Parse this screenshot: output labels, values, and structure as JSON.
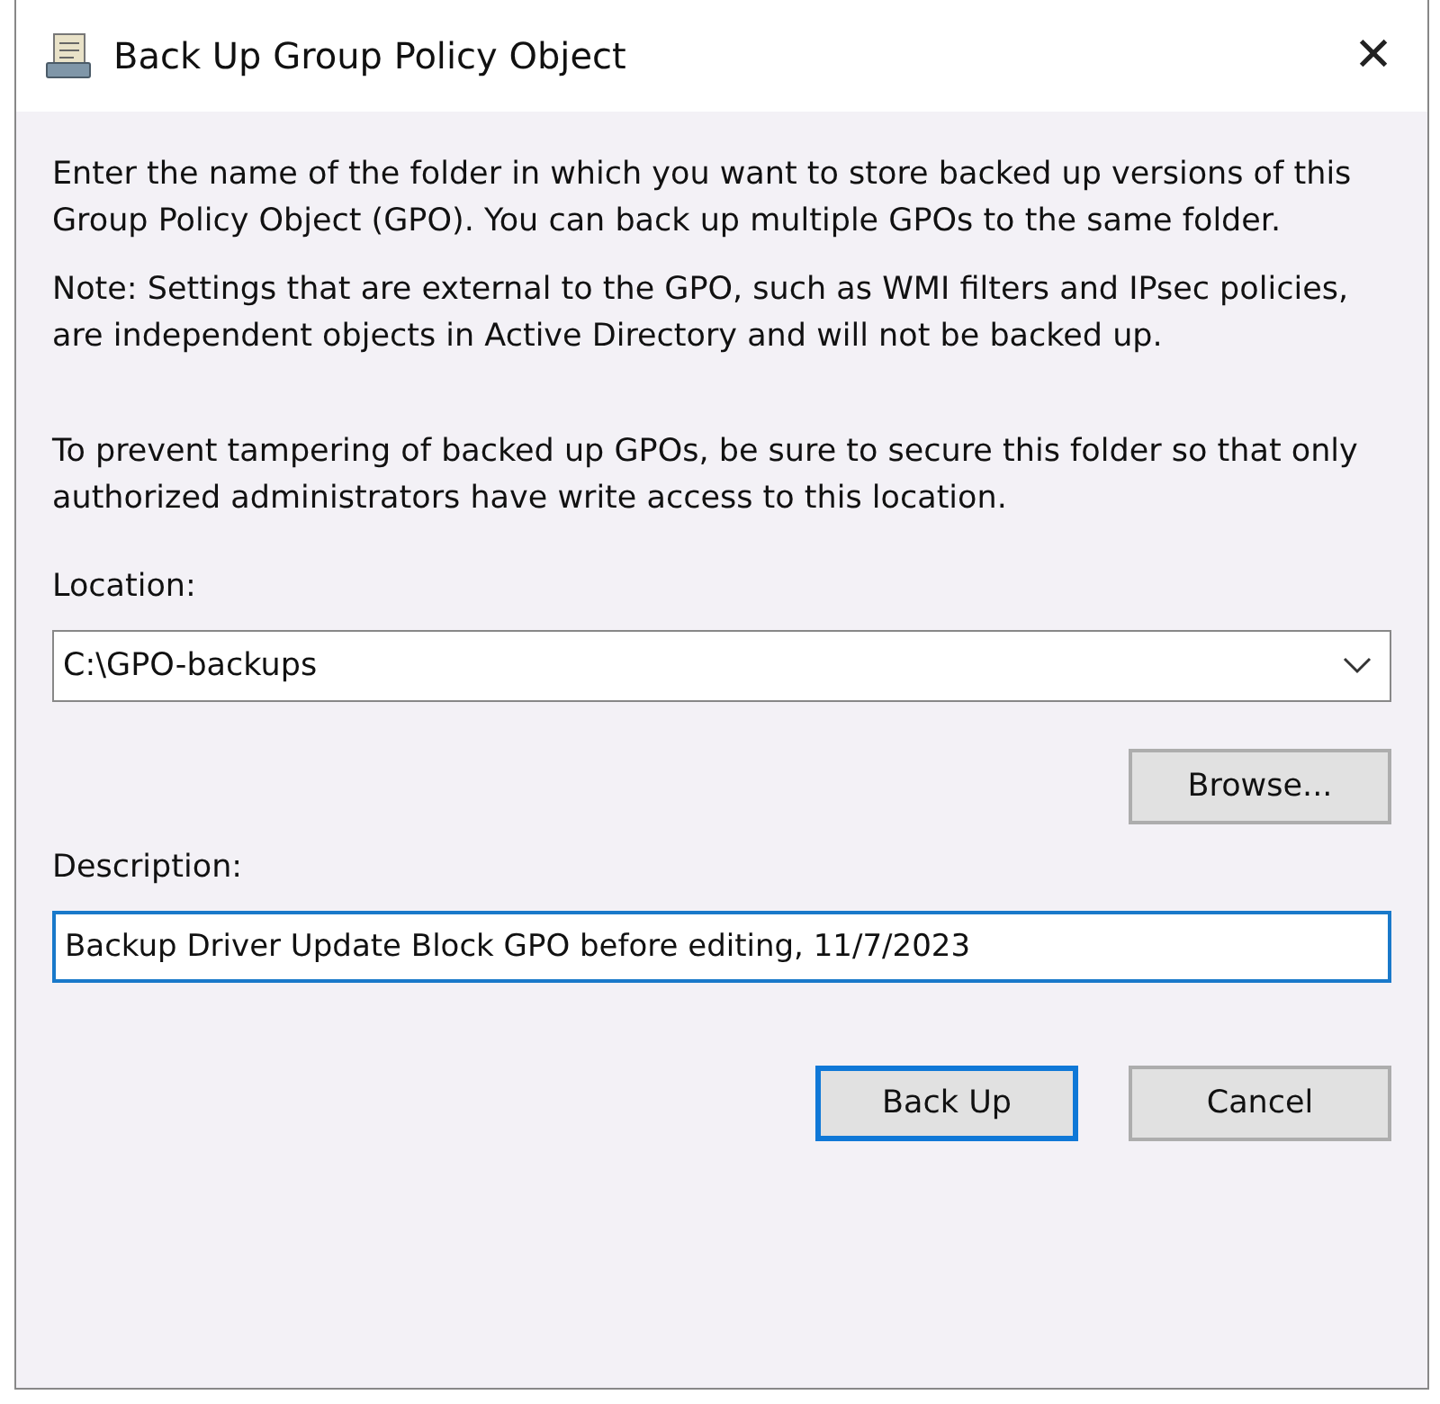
{
  "window": {
    "title": "Back Up Group Policy Object",
    "close": "✕"
  },
  "paragraphs": [
    "Enter the name of the folder in which you want to store backed up versions of this Group Policy Object (GPO). You can back up multiple GPOs to the same folder.",
    "Note: Settings that are external to the GPO, such as WMI filters and IPsec policies, are independent objects in Active Directory and will not be backed up.",
    "To prevent tampering of backed up GPOs, be sure to secure this folder so that only authorized administrators have write access to this location."
  ],
  "location": {
    "label": "Location:",
    "value": "C:\\GPO-backups"
  },
  "browse_button": "Browse...",
  "description": {
    "label": "Description:",
    "value": "Backup Driver Update Block GPO before editing, 11/7/2023",
    "focused": true
  },
  "buttons": [
    {
      "label": "Back Up",
      "default": true
    },
    {
      "label": "Cancel",
      "default": false
    }
  ]
}
